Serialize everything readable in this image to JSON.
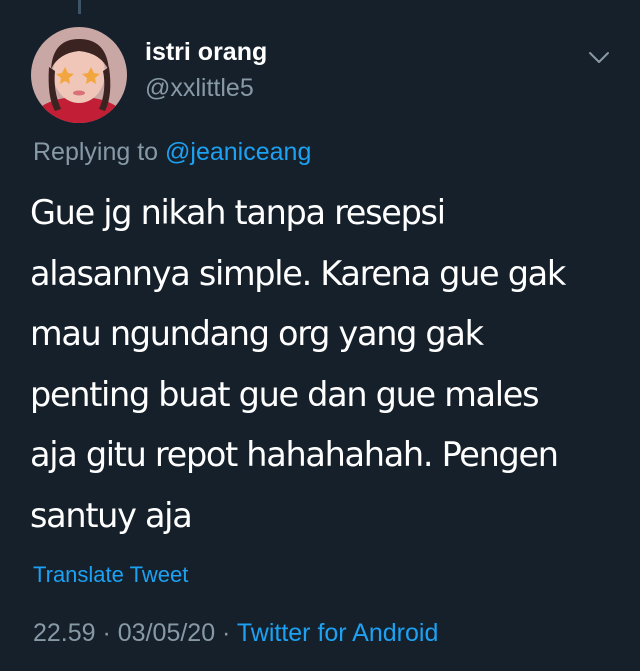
{
  "tweet": {
    "author": {
      "display_name": "istri orang",
      "handle": "@xxlittle5"
    },
    "reply_prefix": "Replying to ",
    "reply_to": "@jeaniceang",
    "text_lines": [
      "Gue jg nikah tanpa resepsi",
      "alasannya simple. Karena gue gak",
      "mau ngundang org yang gak",
      "penting buat gue dan gue males",
      "aja gitu repot hahahahah. Pengen",
      "santuy aja"
    ],
    "translate_label": "Translate Tweet",
    "time": "22.59",
    "separator": " · ",
    "date": "03/05/20",
    "source": "Twitter for Android"
  },
  "colors": {
    "background": "#15202b",
    "text_primary": "#ffffff",
    "text_secondary": "#8899a6",
    "accent": "#1da1f2"
  },
  "icons": {
    "menu": "chevron-down-icon"
  }
}
